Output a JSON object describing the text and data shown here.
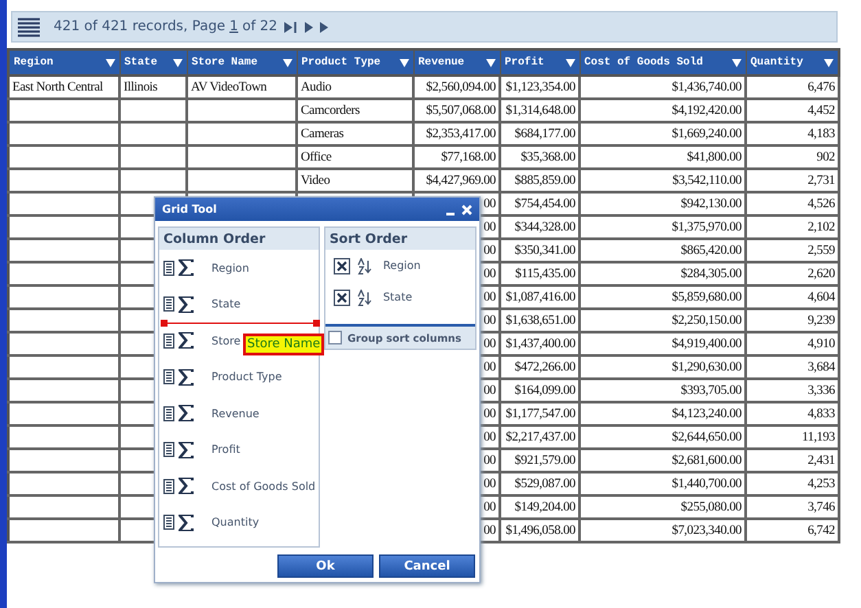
{
  "toolbar": {
    "records_text": "421 of 421 records, Page",
    "page_link": "1",
    "pages_text": "of 22"
  },
  "table": {
    "columns": [
      "Region",
      "State",
      "Store Name",
      "Product Type",
      "Revenue",
      "Profit",
      "Cost of Goods Sold",
      "Quantity"
    ],
    "rows": [
      [
        "East North Central",
        "Illinois",
        "AV VideoTown",
        "Audio",
        "$2,560,094.00",
        "$1,123,354.00",
        "$1,436,740.00",
        "6,476"
      ],
      [
        "",
        "",
        "",
        "Camcorders",
        "$5,507,068.00",
        "$1,314,648.00",
        "$4,192,420.00",
        "4,452"
      ],
      [
        "",
        "",
        "",
        "Cameras",
        "$2,353,417.00",
        "$684,177.00",
        "$1,669,240.00",
        "4,183"
      ],
      [
        "",
        "",
        "",
        "Office",
        "$77,168.00",
        "$35,368.00",
        "$41,800.00",
        "902"
      ],
      [
        "",
        "",
        "",
        "Video",
        "$4,427,969.00",
        "$885,859.00",
        "$3,542,110.00",
        "2,731"
      ],
      [
        "",
        "",
        "",
        "",
        "00",
        "$754,454.00",
        "$942,130.00",
        "4,526"
      ],
      [
        "",
        "",
        "",
        "",
        "00",
        "$344,328.00",
        "$1,375,970.00",
        "2,102"
      ],
      [
        "",
        "",
        "",
        "",
        "00",
        "$350,341.00",
        "$865,420.00",
        "2,559"
      ],
      [
        "",
        "",
        "",
        "",
        "00",
        "$115,435.00",
        "$284,305.00",
        "2,620"
      ],
      [
        "",
        "",
        "",
        "",
        "00",
        "$1,087,416.00",
        "$5,859,680.00",
        "4,604"
      ],
      [
        "",
        "",
        "",
        "",
        "00",
        "$1,638,651.00",
        "$2,250,150.00",
        "9,239"
      ],
      [
        "",
        "",
        "",
        "",
        "00",
        "$1,437,400.00",
        "$4,919,400.00",
        "4,910"
      ],
      [
        "",
        "",
        "",
        "",
        "00",
        "$472,266.00",
        "$1,290,630.00",
        "3,684"
      ],
      [
        "",
        "",
        "",
        "",
        "00",
        "$164,099.00",
        "$393,705.00",
        "3,336"
      ],
      [
        "",
        "",
        "",
        "",
        "00",
        "$1,177,547.00",
        "$4,123,240.00",
        "4,833"
      ],
      [
        "",
        "",
        "",
        "",
        "00",
        "$2,217,437.00",
        "$2,644,650.00",
        "11,193"
      ],
      [
        "",
        "",
        "",
        "",
        "00",
        "$921,579.00",
        "$2,681,600.00",
        "2,431"
      ],
      [
        "",
        "",
        "",
        "",
        "00",
        "$529,087.00",
        "$1,440,700.00",
        "4,253"
      ],
      [
        "",
        "",
        "",
        "",
        "00",
        "$149,204.00",
        "$255,080.00",
        "3,746"
      ],
      [
        "",
        "",
        "",
        "",
        "00",
        "$1,496,058.00",
        "$7,023,340.00",
        "6,742"
      ]
    ]
  },
  "dialog": {
    "title": "Grid Tool",
    "column_order": {
      "title": "Column Order",
      "items": [
        "Region",
        "State",
        "Store",
        "Product Type",
        "Revenue",
        "Profit",
        "Cost of Goods Sold",
        "Quantity"
      ],
      "drag_label": "Store Name"
    },
    "sort_order": {
      "title": "Sort Order",
      "items": [
        {
          "label": "Region",
          "checked": true
        },
        {
          "label": "State",
          "checked": true
        }
      ],
      "group_sort": {
        "label": "Group sort columns",
        "checked": false
      }
    },
    "buttons": [
      "Ok",
      "Cancel"
    ]
  }
}
